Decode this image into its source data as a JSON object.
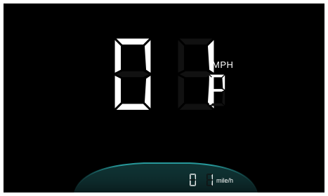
{
  "speed": {
    "digits": [
      "0",
      "1"
    ],
    "gear": "P",
    "unit": "MPH"
  },
  "odometer": {
    "digits": [
      "0",
      "1"
    ],
    "unit": "mile/h"
  },
  "colors": {
    "background": "#000000",
    "digit": "#ffffff",
    "arc_glow": "#2aa6a8"
  }
}
